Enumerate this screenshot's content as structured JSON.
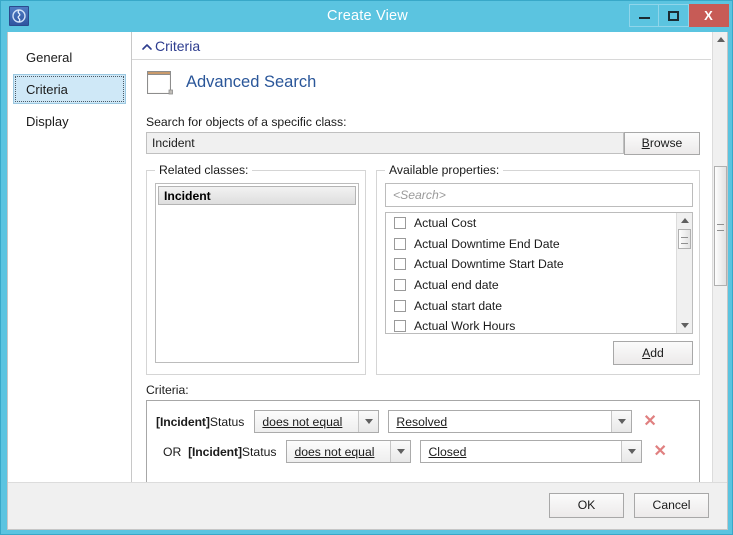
{
  "window": {
    "title": "Create View",
    "app_icon": "app-icon",
    "controls": {
      "minimize": "minimize-button",
      "maximize": "maximize-button",
      "close": "X"
    }
  },
  "sidebar": {
    "items": [
      {
        "label": "General",
        "selected": false
      },
      {
        "label": "Criteria",
        "selected": true
      },
      {
        "label": "Display",
        "selected": false
      }
    ]
  },
  "section": {
    "header_label": "Criteria",
    "chevron": "chevron-up-icon",
    "expanded": true
  },
  "main": {
    "page_title": "Advanced Search",
    "page_icon": "document-icon",
    "class_label": "Search for objects of a specific class:",
    "class_value": "Incident",
    "browse_button": "Browse",
    "browse_accel": "B",
    "related_classes": {
      "group_label": "Related classes:",
      "items": [
        {
          "label": "Incident",
          "selected": true
        }
      ]
    },
    "available_properties": {
      "group_label": "Available properties:",
      "search_placeholder": "<Search>",
      "add_button": "Add",
      "add_accel": "A",
      "items": [
        {
          "label": "Actual Cost",
          "checked": false
        },
        {
          "label": "Actual Downtime End Date",
          "checked": false
        },
        {
          "label": "Actual Downtime Start Date",
          "checked": false
        },
        {
          "label": "Actual end date",
          "checked": false
        },
        {
          "label": "Actual start date",
          "checked": false
        },
        {
          "label": "Actual Work Hours",
          "checked": false
        }
      ]
    },
    "criteria": {
      "label": "Criteria:",
      "rows": [
        {
          "conjunction": "",
          "object": "[Incident]",
          "property": "Status",
          "operator": "does not equal",
          "value": "Resolved",
          "delete_icon": "✕"
        },
        {
          "conjunction": "OR",
          "object": "[Incident]",
          "property": "Status",
          "operator": "does not equal",
          "value": "Closed",
          "delete_icon": "✕"
        }
      ]
    }
  },
  "footer": {
    "ok_label": "OK",
    "cancel_label": "Cancel"
  },
  "colors": {
    "titlebar": "#5bc4e0",
    "close_button": "#c75b56",
    "accent_link": "#2a5699",
    "section_title": "#2e3d8f",
    "selection": "#cfe8f7",
    "delete_x": "#e08080"
  }
}
